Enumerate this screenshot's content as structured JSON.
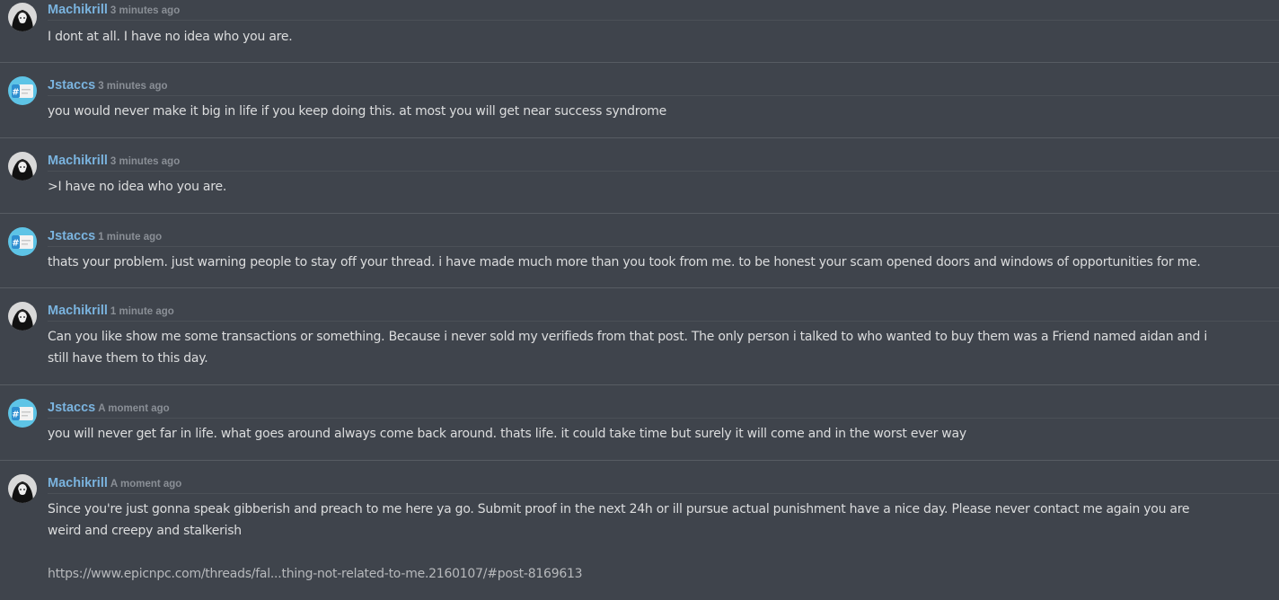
{
  "colors": {
    "background": "#3f444c",
    "author": "#7ab3de",
    "timestamp": "#8a8f96",
    "text": "#dcddde",
    "link": "#b7b9bc",
    "divider": "#575c63"
  },
  "messages": [
    {
      "author": "Machikrill",
      "time": "3 minutes ago",
      "avatar_icon": "dark-anime-avatar-icon",
      "lines": [
        "I dont at all. I have no idea who you are."
      ]
    },
    {
      "author": "Jstaccs",
      "time": "3 minutes ago",
      "avatar_icon": "hashtag-card-avatar-icon",
      "lines": [
        "you would never make it big in life if you keep doing this. at most you will get near success syndrome"
      ]
    },
    {
      "author": "Machikrill",
      "time": "3 minutes ago",
      "avatar_icon": "dark-anime-avatar-icon",
      "lines": [
        ">I have no idea who you are."
      ]
    },
    {
      "author": "Jstaccs",
      "time": "1 minute ago",
      "avatar_icon": "hashtag-card-avatar-icon",
      "lines": [
        "thats your problem. just warning people to stay off your thread. i have made much more than you took from me. to be honest your scam opened doors and windows of opportunities for me."
      ]
    },
    {
      "author": "Machikrill",
      "time": "1 minute ago",
      "avatar_icon": "dark-anime-avatar-icon",
      "lines": [
        "Can you like show me some transactions or something. Because i never sold my verifieds from that post. The only person i talked to who wanted to buy them was a Friend named aidan and i",
        "still have them to this day."
      ]
    },
    {
      "author": "Jstaccs",
      "time": "A moment ago",
      "avatar_icon": "hashtag-card-avatar-icon",
      "lines": [
        "you will never get far in life. what goes around always come back around. thats life. it could take time but surely it will come and in the worst ever way"
      ]
    },
    {
      "author": "Machikrill",
      "time": "A moment ago",
      "avatar_icon": "dark-anime-avatar-icon",
      "lines": [
        "Since you're just gonna speak gibberish and preach to me here ya go. Submit proof in the next 24h or ill pursue actual punishment have a nice day. Please never contact me again you are",
        "weird and creepy and stalkerish"
      ],
      "link": "https://www.epicnpc.com/threads/fal...thing-not-related-to-me.2160107/#post-8169613"
    }
  ]
}
